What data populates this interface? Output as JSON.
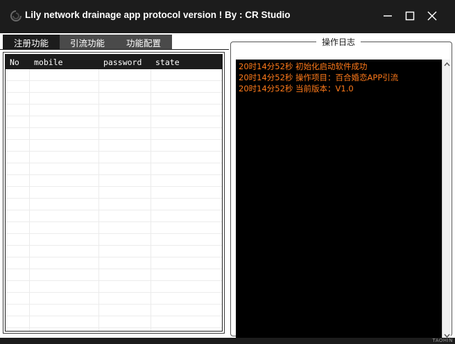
{
  "window": {
    "title": "Lily network drainage app protocol version ! By : CR Studio",
    "app_icon": "app-logo-icon",
    "controls": [
      "minimize-icon",
      "maximize-icon",
      "close-icon"
    ]
  },
  "tabs": [
    {
      "label": "注册功能",
      "active": true
    },
    {
      "label": "引流功能",
      "active": false
    },
    {
      "label": "功能配置",
      "active": false
    }
  ],
  "table": {
    "columns": [
      "No",
      "mobile",
      "password",
      "state"
    ],
    "rows": []
  },
  "log": {
    "title": "操作日志",
    "lines": [
      "20时14分52秒 初始化启动软件成功",
      "20时14分52秒 操作项目：百合婚恋APP引流",
      "20时14分52秒 当前版本：V1.0"
    ],
    "text_color": "#ff7a1a",
    "background": "#000000"
  },
  "footer": {
    "watermark": "TAOHIN"
  },
  "colors": {
    "chrome": "#1c1c1c",
    "tab_inactive": "#4a4a4a",
    "panel": "#ffffff"
  }
}
